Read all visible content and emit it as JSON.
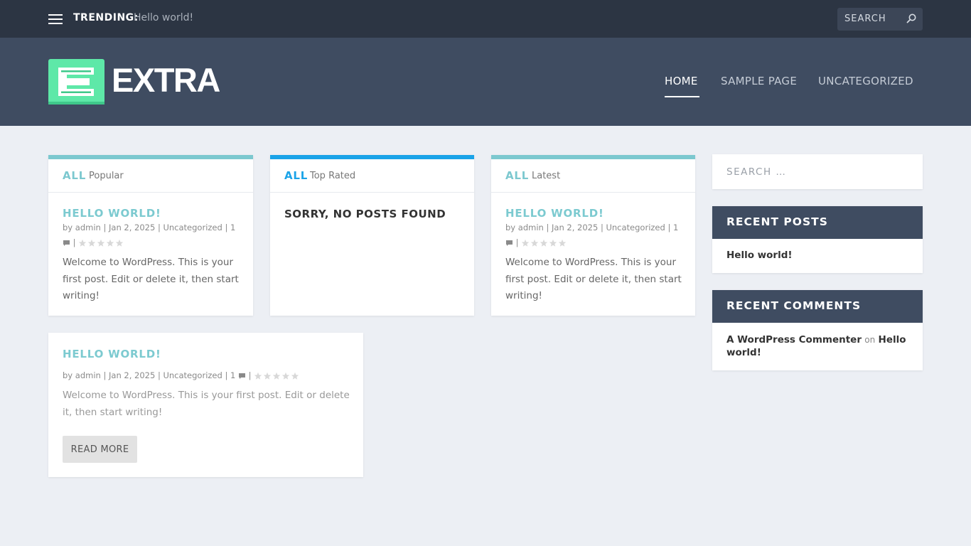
{
  "topbar": {
    "menu_icon": "hamburger-icon",
    "trending_label": "TRENDING:",
    "trending_post": "Hello world!",
    "search_label": "SEARCH",
    "search_icon": "search-icon"
  },
  "header": {
    "logo_text": "EXTRA",
    "logo_color": "#5ee8a8",
    "nav": [
      {
        "label": "HOME",
        "active": true
      },
      {
        "label": "SAMPLE PAGE",
        "active": false
      },
      {
        "label": "UNCATEGORIZED",
        "active": false
      }
    ]
  },
  "cards": [
    {
      "all": "ALL",
      "tab": "Popular",
      "accent": "#7cc8cf",
      "title": "HELLO WORLD!",
      "author": "admin",
      "date": "Jan 2, 2025",
      "category": "Uncategorized",
      "comments": "1",
      "excerpt": "Welcome to WordPress. This is your first post. Edit or delete it, then start writing!"
    },
    {
      "all": "ALL",
      "tab": "Top Rated",
      "accent": "#1aa3e8",
      "empty_text": "SORRY, NO POSTS FOUND"
    },
    {
      "all": "ALL",
      "tab": "Latest",
      "accent": "#7cc8cf",
      "title": "HELLO WORLD!",
      "author": "admin",
      "date": "Jan 2, 2025",
      "category": "Uncategorized",
      "comments": "1",
      "excerpt": "Welcome to WordPress. This is your first post. Edit or delete it, then start writing!"
    }
  ],
  "feature_post": {
    "title": "HELLO WORLD!",
    "by": "by",
    "author": "admin",
    "date": "Jan 2, 2025",
    "category": "Uncategorized",
    "comments": "1",
    "excerpt": "Welcome to WordPress. This is your first post. Edit or delete it, then start writing!",
    "read_more": "READ MORE"
  },
  "meta_by": "by",
  "meta_sep": "|",
  "sidebar": {
    "search_placeholder": "SEARCH …",
    "recent_posts_title": "RECENT POSTS",
    "recent_posts": [
      "Hello world!"
    ],
    "recent_comments_title": "RECENT COMMENTS",
    "comment_author": "A WordPress Commenter",
    "comment_on": "on",
    "comment_post": "Hello world!"
  },
  "rating_stars": 5
}
